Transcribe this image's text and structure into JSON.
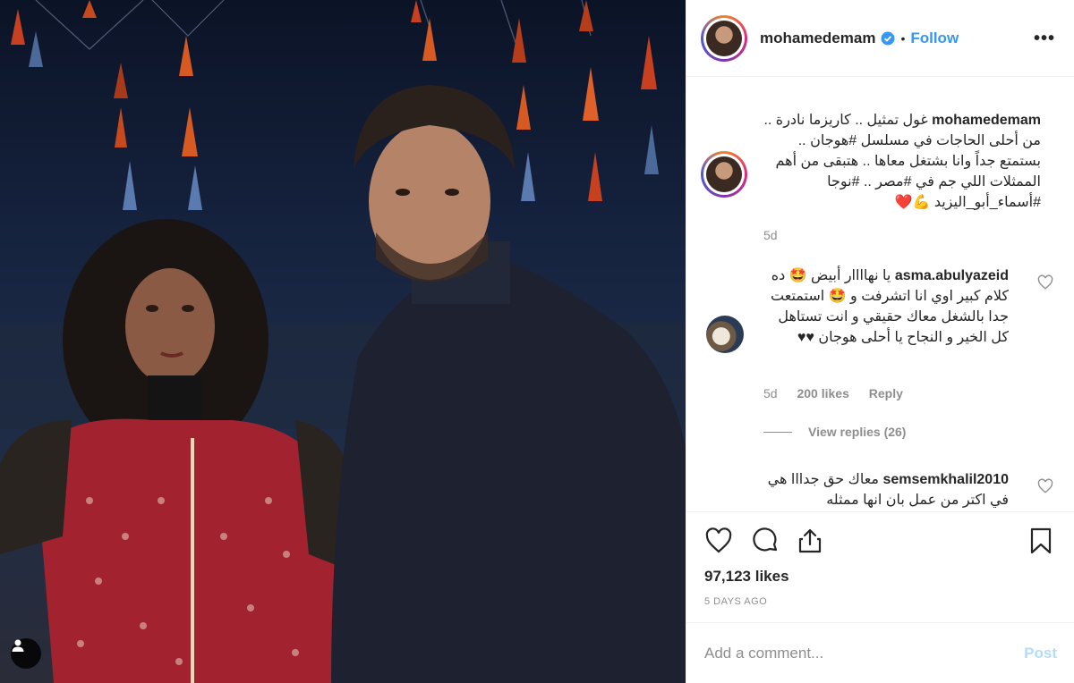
{
  "post": {
    "author": "mohamedemam",
    "follow_label": "Follow",
    "separator": "•",
    "more_label": "•••"
  },
  "caption": {
    "username": "mohamedemam",
    "text": "غول تمثيل .. كاريزما نادرة .. من أحلى الحاجات في مسلسل #هوجان .. بستمتع جداً وانا بشتغل معاها .. هتبقى من أهم الممثلات اللي جم في #مصر .. #نوجا #أسماء_أبو_اليزيد",
    "emojis": "💪❤️",
    "time": "5d"
  },
  "comments": [
    {
      "username": "asma.abulyazeid",
      "text": "يا نهاااار أبيض 🤩 ده كلام كبير اوي انا اتشرفت و 🤩 استمتعت جدا بالشغل معاك حقيقي و انت تستاهل كل الخير و النجاح يا أحلى هوجان ♥♥",
      "time": "5d",
      "likes": "200 likes",
      "reply_label": "Reply",
      "view_replies": "View replies (26)"
    },
    {
      "username": "semsemkhalil2010",
      "text": "معاك حق جدااا هي في اكتر من عمل بان انها ممثله"
    }
  ],
  "actions": {
    "likes": "97,123 likes",
    "posted": "5 DAYS AGO"
  },
  "comment_box": {
    "placeholder": "Add a comment...",
    "post_label": "Post"
  },
  "colors": {
    "accent": "#3897f0",
    "post_disabled": "#b3dbff",
    "muted": "#8e8e8e",
    "text": "#262626"
  },
  "icons": [
    "verified-icon",
    "more-icon",
    "heart-icon",
    "comment-icon",
    "share-icon",
    "bookmark-icon",
    "user-tag-icon"
  ]
}
